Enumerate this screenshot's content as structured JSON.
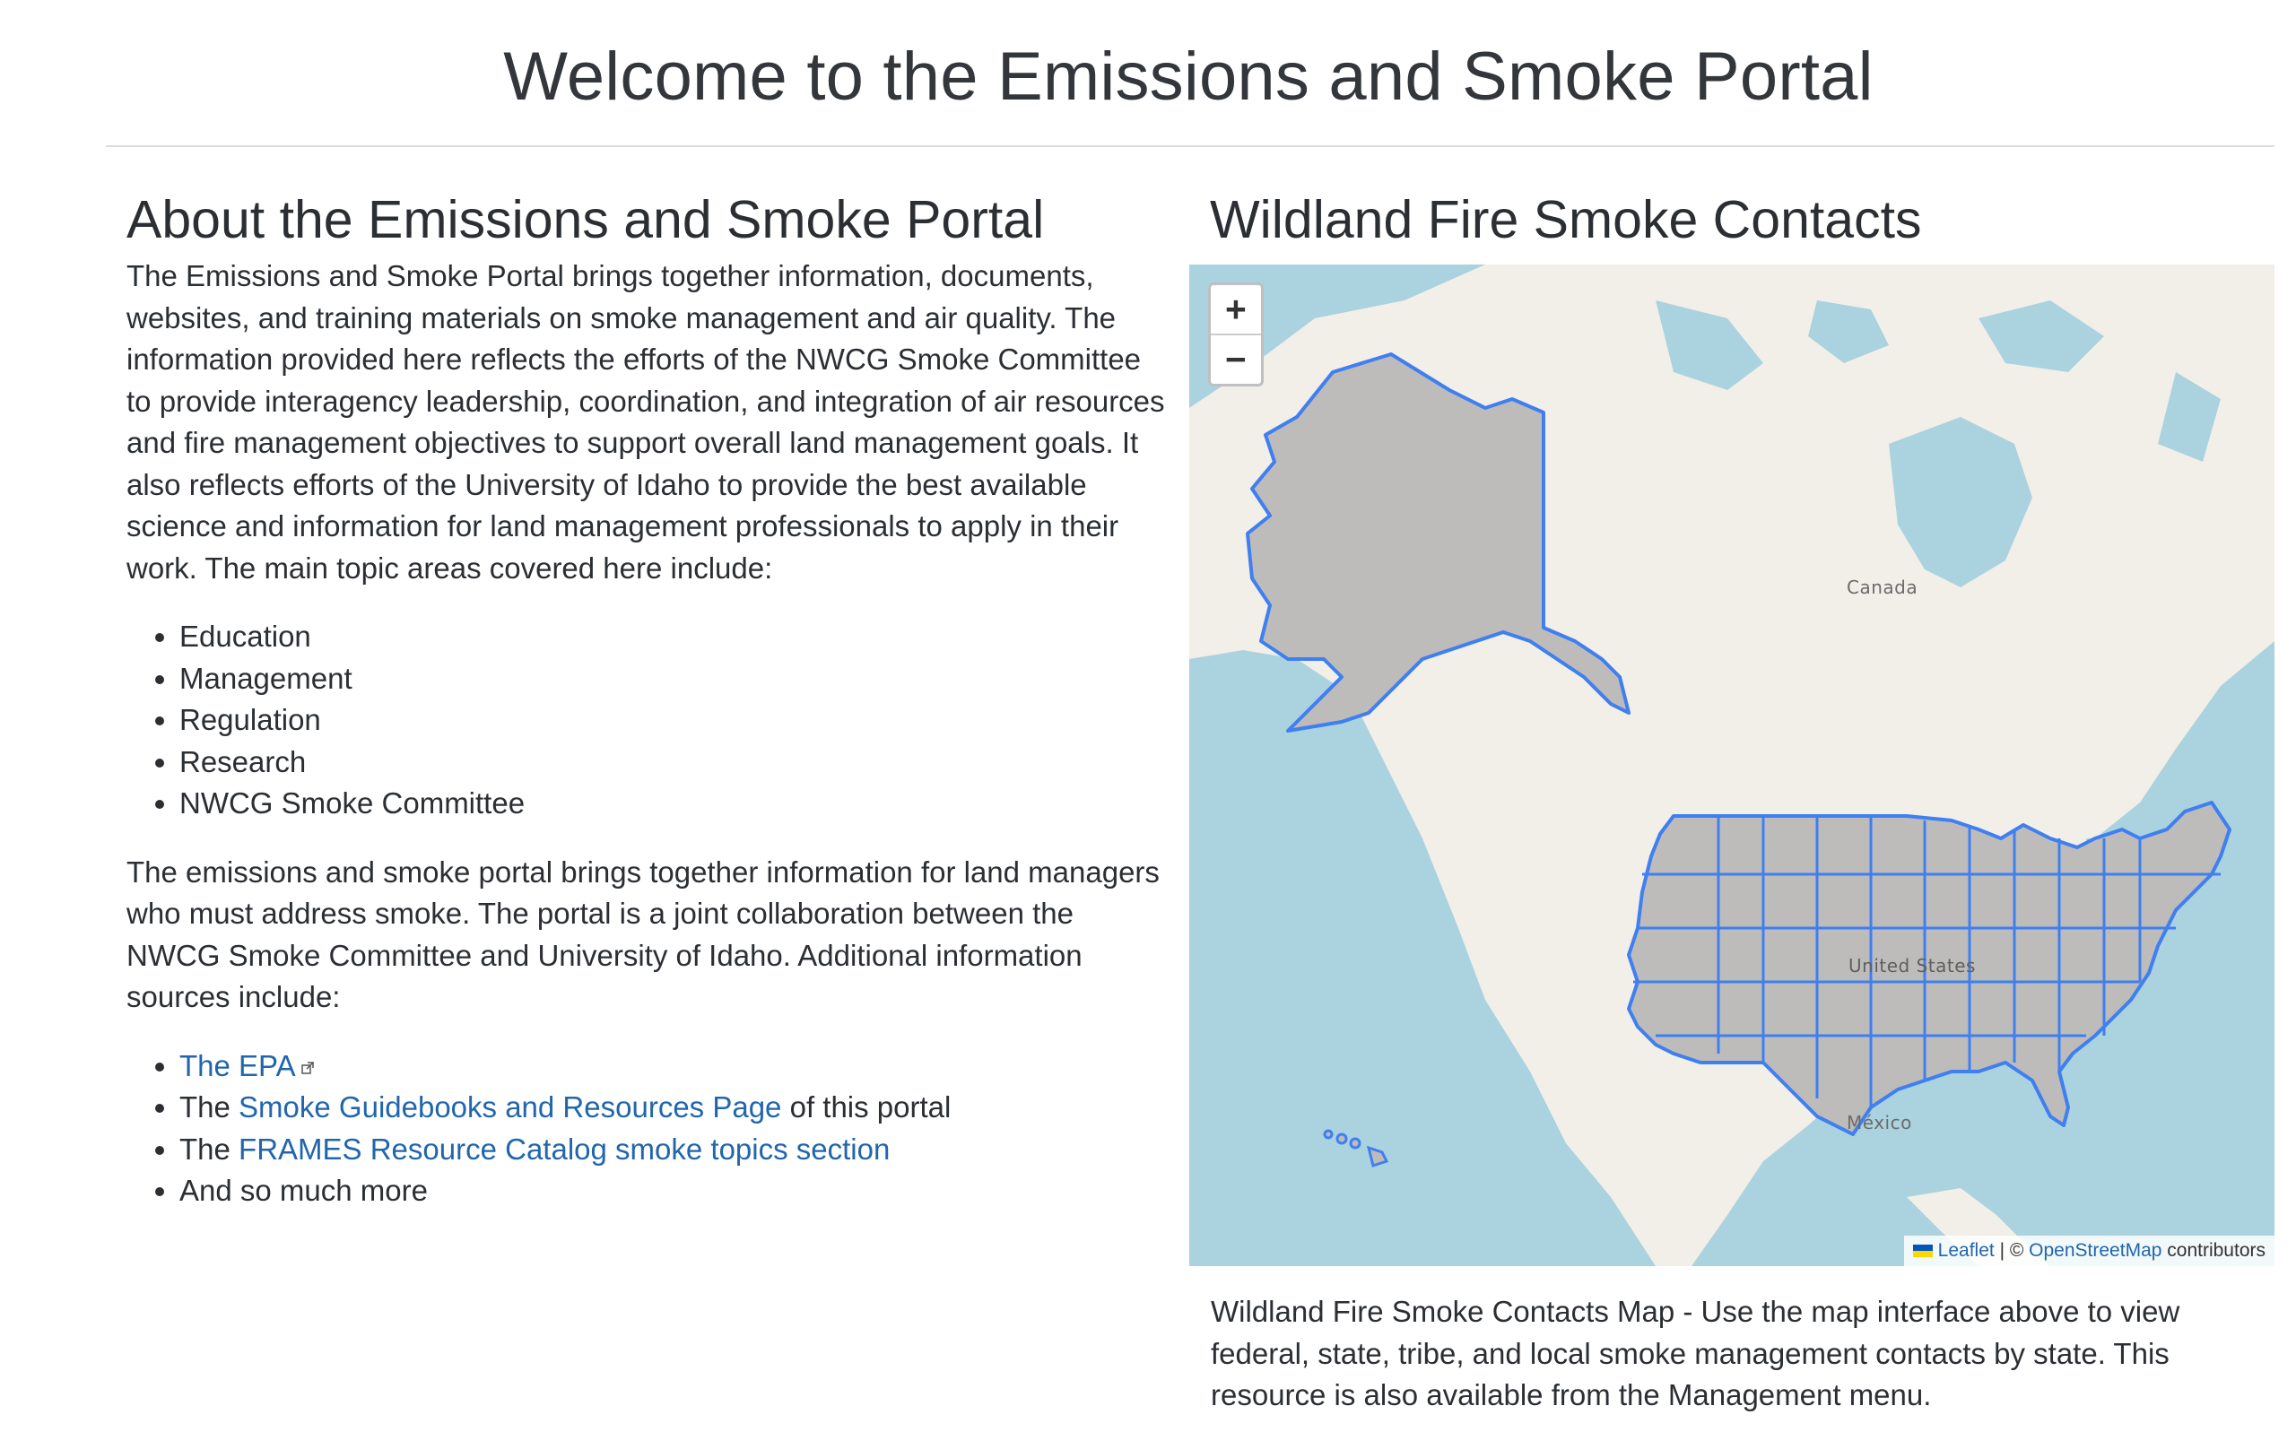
{
  "page": {
    "title": "Welcome to the Emissions and Smoke Portal"
  },
  "about": {
    "heading": "About the Emissions and Smoke Portal",
    "intro": "The Emissions and Smoke Portal brings together information, documents, websites, and training materials on smoke management and air quality. The information provided here reflects the efforts of the NWCG Smoke Committee to provide interagency leadership, coordination, and integration of air resources and fire management objectives to support overall land management goals. It also reflects efforts of the University of Idaho to provide the best available science and information for land management professionals to apply in their work. The main topic areas covered here include:",
    "topics": [
      "Education",
      "Management",
      "Regulation",
      "Research",
      "NWCG Smoke Committee"
    ],
    "second_paragraph": "The emissions and smoke portal brings together information for land managers who must address smoke. The portal is a joint collaboration between the NWCG Smoke Committee and University of Idaho. Additional information sources include:",
    "sources": [
      {
        "prefix": "",
        "link": "The EPA",
        "suffix": ""
      },
      {
        "prefix": "The ",
        "link": "Smoke Guidebooks and Resources Page",
        "suffix": " of this portal"
      },
      {
        "prefix": "The ",
        "link": "FRAMES Resource Catalog smoke topics section",
        "suffix": ""
      },
      {
        "prefix": "",
        "link": "",
        "suffix": "And so much more"
      }
    ]
  },
  "contacts": {
    "heading": "Wildland Fire Smoke Contacts",
    "map": {
      "zoom_in": "+",
      "zoom_out": "−",
      "labels": {
        "canada": "Canada",
        "usa": "United States",
        "mexico": "México"
      },
      "attribution": {
        "leaflet": "Leaflet",
        "sep": " | © ",
        "osm": "OpenStreetMap",
        "tail": " contributors"
      },
      "colors": {
        "water": "#aad3df",
        "land": "#f2efe9",
        "state_fill": "#bdbcba",
        "state_stroke": "#3f7ff0"
      }
    },
    "caption": "Wildland Fire Smoke Contacts Map - Use the map interface above to view federal, state, tribe, and local smoke management contacts by state. This resource is also available from the Management menu."
  }
}
